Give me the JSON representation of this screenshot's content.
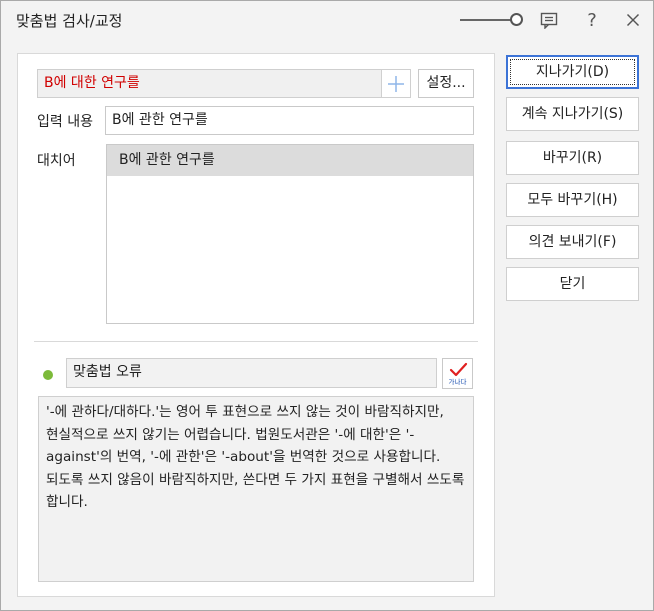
{
  "window": {
    "title": "맞춤법 검사/교정",
    "zoom_level": 1.0
  },
  "check": {
    "error_word": "B에 대한 연구를",
    "settings_label": "설정...",
    "input_label": "입력 내용",
    "input_value": "B에 관한 연구를",
    "suggestions_label": "대치어",
    "suggestions": [
      "B에 관한 연구를"
    ],
    "rule_name": "맞춤법 오류",
    "rule_icon_text": "가나다",
    "description": "'-에 관하다/대하다.'는 영어 투 표현으로 쓰지 않는 것이 바람직하지만, 현실적으로 쓰지 않기는 어렵습니다. 법원도서관은 '-에 대한'은 '-against'의 번역, '-에 관한'은 '-about'을 번역한 것으로 사용합니다. 되도록 쓰지 않음이 바람직하지만, 쓴다면 두 가지 표현을 구별해서 쓰도록 합니다."
  },
  "buttons": {
    "skip": "지나가기(D)",
    "skip_all": "계속 지나가기(S)",
    "replace": "바꾸기(R)",
    "replace_all": "모두 바꾸기(H)",
    "send_feedback": "의견 보내기(F)",
    "close": "닫기"
  },
  "colors": {
    "accent": "#3c73d6",
    "error_text": "#d00000",
    "status_dot": "#7cba3a"
  }
}
